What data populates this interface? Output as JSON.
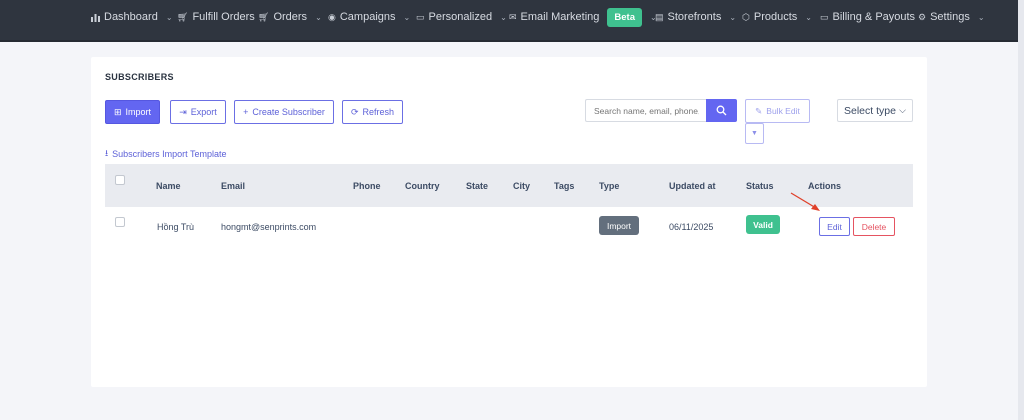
{
  "nav": {
    "items": [
      {
        "label": "Dashboard",
        "icon": "bar-chart-icon",
        "has_caret": true
      },
      {
        "label": "Fulfill Orders",
        "icon": "cart-icon",
        "has_caret": false
      },
      {
        "label": "Orders",
        "icon": "cart-icon",
        "has_caret": true
      },
      {
        "label": "Campaigns",
        "icon": "target-icon",
        "has_caret": true
      },
      {
        "label": "Personalized",
        "icon": "chat-icon",
        "has_caret": true
      },
      {
        "label": "Email Marketing",
        "icon": "envelope-icon",
        "has_caret": true,
        "badge": "Beta"
      },
      {
        "label": "Storefronts",
        "icon": "storefront-icon",
        "has_caret": true
      },
      {
        "label": "Products",
        "icon": "box-icon",
        "has_caret": true
      },
      {
        "label": "Billing & Payouts",
        "icon": "card-icon",
        "has_caret": false
      },
      {
        "label": "Settings",
        "icon": "gear-icon",
        "has_caret": true
      }
    ]
  },
  "page": {
    "title": "SUBSCRIBERS"
  },
  "toolbar": {
    "import_label": "Import",
    "export_label": "Export",
    "create_label": "Create Subscriber",
    "refresh_label": "Refresh",
    "search_placeholder": "Search name, email, phone,",
    "bulk_edit_label": "Bulk Edit",
    "select_type_label": "Select type",
    "template_link_label": "Subscribers Import Template"
  },
  "table": {
    "columns": [
      "Name",
      "Email",
      "Phone",
      "Country",
      "State",
      "City",
      "Tags",
      "Type",
      "Updated at",
      "Status",
      "Actions"
    ],
    "rows": [
      {
        "name": "Hồng Trù",
        "email": "hongmt@senprints.com",
        "phone": "",
        "country": "",
        "state": "",
        "city": "",
        "tags": "",
        "type": "Import",
        "updated_at": "06/11/2025",
        "status": "Valid",
        "edit_label": "Edit",
        "delete_label": "Delete"
      }
    ]
  },
  "colors": {
    "nav_bg": "#2f353f",
    "primary": "#6366f1",
    "success": "#3fc18f",
    "danger": "#e55361",
    "annotation_arrow": "#e0402a"
  }
}
